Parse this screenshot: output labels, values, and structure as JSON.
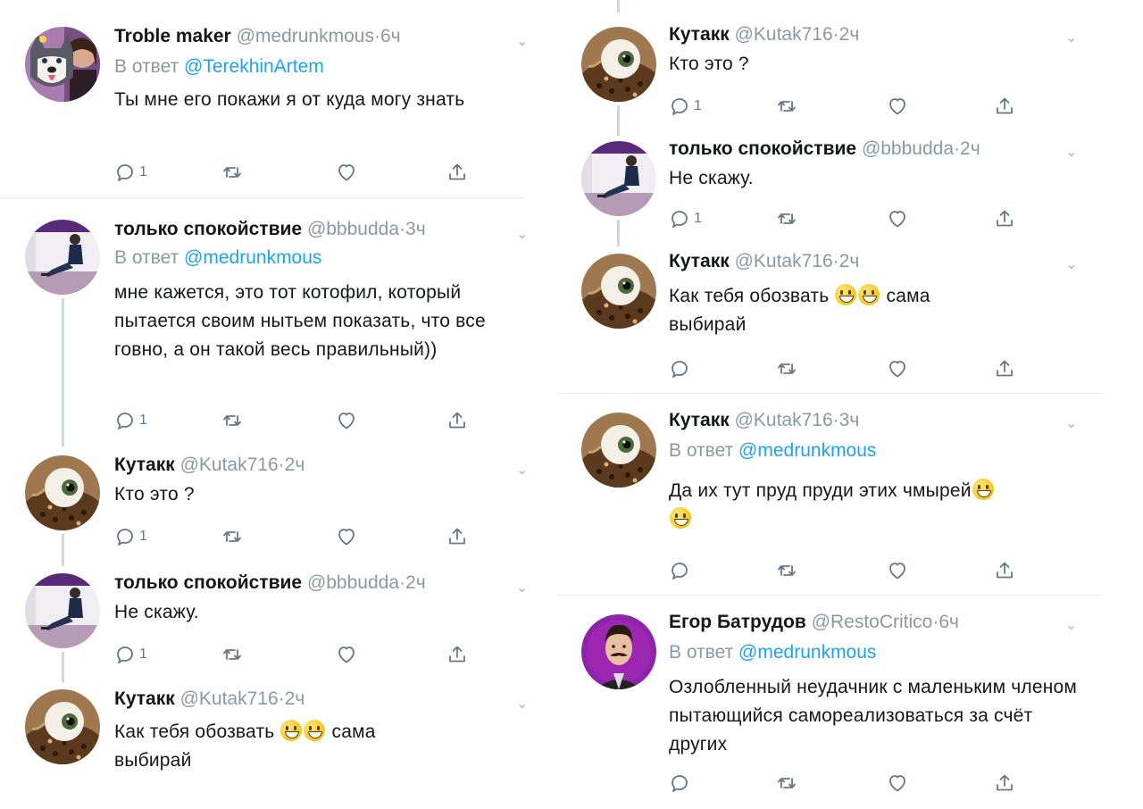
{
  "left_column": {
    "tweets": [
      {
        "name": "Troble maker",
        "handle": "@medrunkmous",
        "time": "6ч",
        "reply_prefix": "В ответ",
        "reply_to": "@TerekhinArtem",
        "text": "Ты мне его покажи я от куда могу знать",
        "replies": "1",
        "avatar": "husky-girl"
      },
      {
        "name": "только спокойствие",
        "handle": "@bbbudda",
        "time": "3ч",
        "reply_prefix": "В ответ",
        "reply_to": "@medrunkmous",
        "text": "мне кажется, это тот котофил, который пытается своим нытьем показать, что все говно, а он такой весь правильный))",
        "replies": "1",
        "avatar": "sitting-figure"
      },
      {
        "name": "Кутакк",
        "handle": "@Kutak716",
        "time": "2ч",
        "text": "Кто это ?",
        "replies": "1",
        "avatar": "eyeball"
      },
      {
        "name": "только спокойствие",
        "handle": "@bbbudda",
        "time": "2ч",
        "text": "Не скажу.",
        "replies": "1",
        "avatar": "sitting-figure"
      },
      {
        "name": "Кутакк",
        "handle": "@Kutak716",
        "time": "2ч",
        "text_before": "Как тебя обозвать",
        "text_after": "сама",
        "text_line2": "выбирай",
        "avatar": "eyeball"
      }
    ]
  },
  "right_column": {
    "tweets": [
      {
        "name": "Кутакк",
        "handle": "@Kutak716",
        "time": "2ч",
        "text": "Кто это ?",
        "replies": "1",
        "avatar": "eyeball"
      },
      {
        "name": "только спокойствие",
        "handle": "@bbbudda",
        "time": "2ч",
        "text": "Не скажу.",
        "replies": "1",
        "avatar": "sitting-figure"
      },
      {
        "name": "Кутакк",
        "handle": "@Kutak716",
        "time": "2ч",
        "text_before": "Как тебя обозвать",
        "text_after": "сама",
        "text_line2": "выбирай",
        "avatar": "eyeball"
      },
      {
        "name": "Кутакк",
        "handle": "@Kutak716",
        "time": "3ч",
        "reply_prefix": "В ответ",
        "reply_to": "@medrunkmous",
        "text": "Да их тут пруд пруди этих чмырей",
        "avatar": "eyeball"
      },
      {
        "name": "Егор Батрудов",
        "handle": "@RestoCritico",
        "time": "6ч",
        "reply_prefix": "В ответ",
        "reply_to": "@medrunkmous",
        "text": "Озлобленный неудачник с маленьким членом пытающийся самореализоваться за счёт других",
        "avatar": "mustache-man"
      }
    ]
  },
  "separator": "·",
  "icons": [
    "reply-icon",
    "retweet-icon",
    "like-icon",
    "share-icon",
    "chevron-down-icon"
  ],
  "colors": {
    "mention": "#1da1f2",
    "secondary": "#8899a6",
    "text": "#14171a",
    "divider": "#e6ecf0",
    "thread_line": "#ccd6dd"
  }
}
